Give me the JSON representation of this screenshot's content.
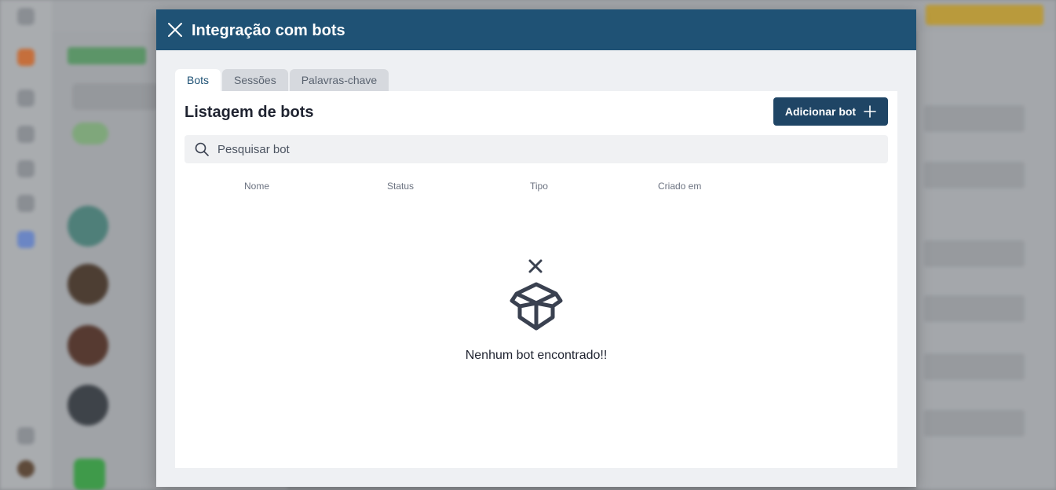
{
  "modal": {
    "title": "Integração com bots",
    "tabs": [
      {
        "label": "Bots",
        "active": true
      },
      {
        "label": "Sessões",
        "active": false
      },
      {
        "label": "Palavras-chave",
        "active": false
      }
    ],
    "list_title": "Listagem de bots",
    "add_button_label": "Adicionar bot",
    "search": {
      "placeholder": "Pesquisar bot",
      "value": ""
    },
    "columns": [
      "Nome",
      "Status",
      "Tipo",
      "Criado em"
    ],
    "empty_message": "Nenhum bot encontrado!!"
  },
  "colors": {
    "header": "#1f5275",
    "primary_button": "#1f4565",
    "tab_active_text": "#1f5275",
    "empty_icon": "#3a4150"
  },
  "icons": {
    "close": "close-icon",
    "add": "plus-icon",
    "search": "search-icon",
    "empty_state": "empty-box-icon"
  }
}
